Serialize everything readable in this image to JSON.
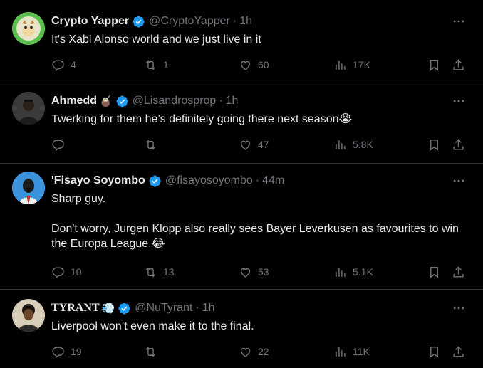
{
  "tweets": [
    {
      "name": "Crypto Yapper",
      "name_emoji": "",
      "handle": "@CryptoYapper",
      "time": "1h",
      "text": "It's Xabi Alonso world and we just live in it",
      "replies": "4",
      "retweets": "1",
      "likes": "60",
      "views": "17K",
      "avatar_color": "#59b84a"
    },
    {
      "name": "Ahmedd",
      "name_emoji": "🧉",
      "handle": "@Lisandrosprop",
      "time": "1h",
      "text": "Twerking for them he’s definitely going there next season😭",
      "replies": "",
      "retweets": "",
      "likes": "47",
      "views": "5.8K",
      "avatar_color": "#3a3a3a"
    },
    {
      "name": "'Fisayo Soyombo",
      "name_emoji": "",
      "handle": "@fisayosoyombo",
      "time": "44m",
      "text": "Sharp guy.\n\nDon't worry, Jurgen Klopp also really sees Bayer Leverkusen as favourites to win the Europa League.😂",
      "replies": "10",
      "retweets": "13",
      "likes": "53",
      "views": "5.1K",
      "avatar_color": "#3b8fd9"
    },
    {
      "name": "TYRANT",
      "name_emoji": "💨",
      "handle": "@NuTyrant",
      "time": "1h",
      "text": "Liverpool won’t even make it to the final.",
      "replies": "19",
      "retweets": "",
      "likes": "22",
      "views": "11K",
      "avatar_color": "#6b4a2a"
    }
  ],
  "colors": {
    "accent": "#1d9bf0",
    "muted": "#71767b",
    "text": "#e7e9ea",
    "border": "#2f3336"
  }
}
